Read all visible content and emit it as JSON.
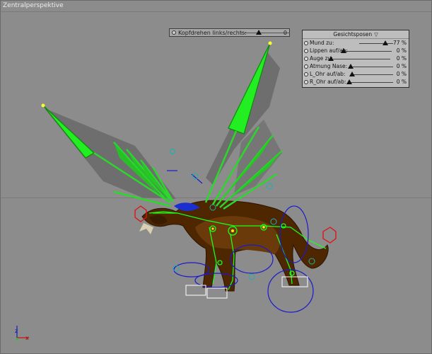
{
  "viewport": {
    "title": "Zentralperspektive",
    "colors": {
      "background": "#8c8c8c",
      "rig": "#19ff19",
      "control": "#1a1acc",
      "dragon": "#5a2a00"
    }
  },
  "head_slider": {
    "label": "Kopfdrehen links/rechts:",
    "value": "0",
    "level": 0.35
  },
  "face_panel": {
    "title": "Gesichtsposen",
    "rows": [
      {
        "label": "Mund zu:",
        "value": "77 %",
        "level": 0.77
      },
      {
        "label": "Lippen auf/ab:",
        "value": "0 %",
        "level": 0
      },
      {
        "label": "Auge zu:",
        "value": "0 %",
        "level": 0
      },
      {
        "label": "Atmung Nase:",
        "value": "0 %",
        "level": 0
      },
      {
        "label": "L_Ohr auf/ab:",
        "value": "0 %",
        "level": 0
      },
      {
        "label": "R_Ohr auf/ab:",
        "value": "0 %",
        "level": 0
      }
    ]
  },
  "axis_gizmo": {
    "z": "z",
    "x": "x"
  }
}
